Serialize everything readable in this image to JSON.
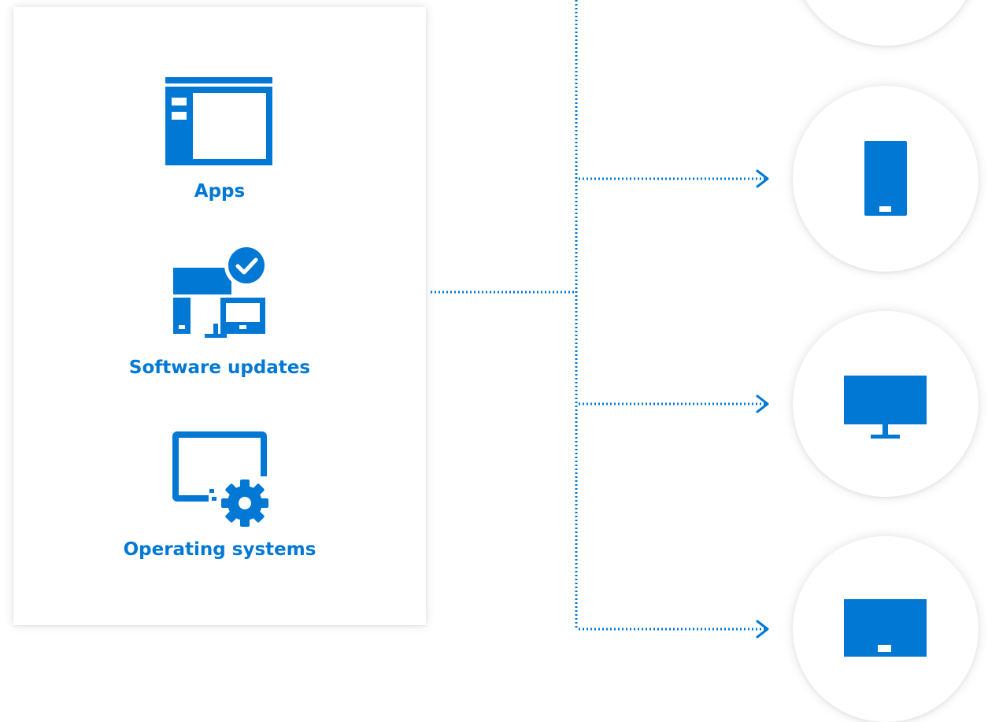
{
  "content_card": {
    "items": [
      {
        "label": "Apps",
        "icon": "app-window-icon"
      },
      {
        "label": "Software updates",
        "icon": "devices-checkmark-icon"
      },
      {
        "label": "Operating systems",
        "icon": "screen-gear-icon"
      }
    ]
  },
  "targets": [
    {
      "icon": "phone-icon"
    },
    {
      "icon": "monitor-icon"
    },
    {
      "icon": "tablet-icon"
    }
  ],
  "colors": {
    "accent": "#0078d4",
    "card_background": "#ffffff",
    "page_background": "#ffffff"
  }
}
